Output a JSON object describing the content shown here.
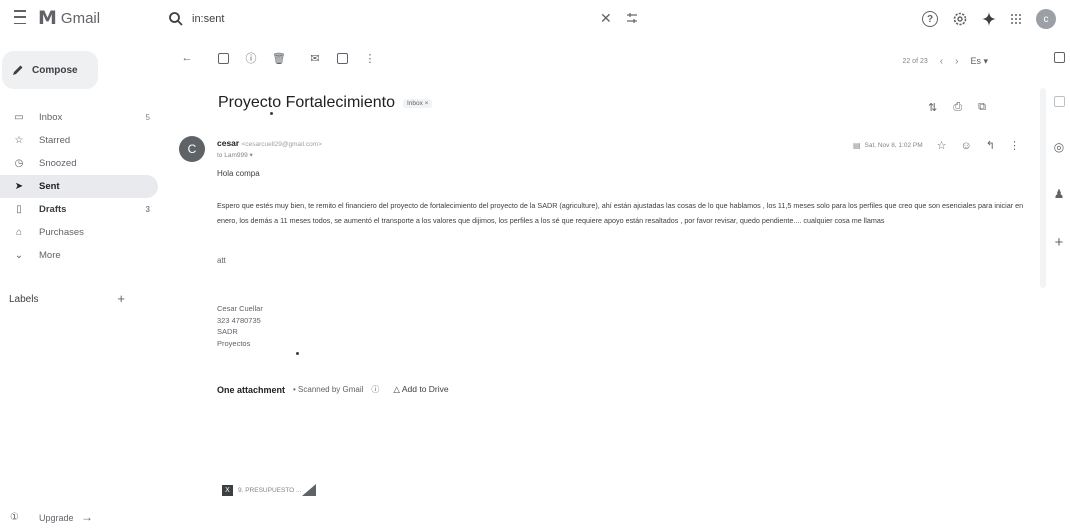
{
  "app": {
    "name": "Gmail"
  },
  "search": {
    "query": "in:sent"
  },
  "sidebar": {
    "compose_label": "Compose",
    "items": [
      {
        "label": "Inbox",
        "count": "5",
        "icon": "inbox-icon"
      },
      {
        "label": "Starred",
        "count": "",
        "icon": "star-icon"
      },
      {
        "label": "Snoozed",
        "count": "",
        "icon": "clock-icon"
      },
      {
        "label": "Sent",
        "count": "",
        "icon": "send-icon"
      },
      {
        "label": "Drafts",
        "count": "3",
        "icon": "draft-icon"
      },
      {
        "label": "Purchases",
        "count": "",
        "icon": "tag-icon"
      },
      {
        "label": "More",
        "count": "",
        "icon": "chevron-down-icon"
      }
    ],
    "labels_title": "Labels",
    "upgrade_label": "Upgrade"
  },
  "pager": {
    "text": "22 of 23",
    "lang": "Es"
  },
  "message": {
    "subject": "Proyecto Fortalecimiento",
    "badge": "Inbox ×",
    "sender_initial": "C",
    "sender_name": "cesar",
    "sender_email": "<cesarcuell29@gmail.com>",
    "to": "to Lam999 ▾",
    "date": "Sat, Nov 8, 1:02 PM",
    "greeting": "Hola compa",
    "paragraph": "Espero que estés muy bien, te remito el financiero del proyecto de fortalecimiento del proyecto de la SADR (agriculture), ahí están ajustadas las cosas de lo que hablamos , los 11,5 meses solo para los perfiles que creo que son esenciales para iniciar en enero, los demás a 11 meses todos, se aumentó el transporte a los valores que dijimos, los perfiles a los sé que requiere apoyo están resaltados , por favor revisar, quedo pendiente.... cualquier cosa me llamas",
    "att_line": "att",
    "signature": [
      "Cesar Cuellar",
      "323 4780735",
      "SADR",
      "Proyectos"
    ]
  },
  "attachments": {
    "title": "One attachment",
    "scanned": "• Scanned by Gmail",
    "add_to_drive": "Add to Drive",
    "file_name": "9. PRESUPUESTO ..."
  },
  "colors": {
    "active_bg": "#e8eaed",
    "compose_bg": "#eef0f2",
    "text": "#202124"
  }
}
